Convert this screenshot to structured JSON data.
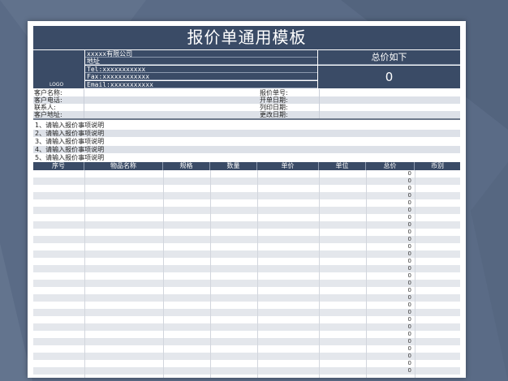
{
  "title": "报价单通用模板",
  "logo_text": "LOGO",
  "company": {
    "lines": [
      "xxxxx有限公司",
      "地址",
      "Tel:xxxxxxxxxxx",
      "Fax:xxxxxxxxxxxx",
      "Email:xxxxxxxxxxx"
    ]
  },
  "total": {
    "label": "总价如下",
    "value": "0"
  },
  "info": {
    "left_labels": [
      "客户名称:",
      "客户电话:",
      "联系人:",
      "客户地址:"
    ],
    "right_labels": [
      "报价单号:",
      "开单日期:",
      "列印日期:",
      "更改日期:"
    ]
  },
  "notes": [
    "1、请输入报价事项说明",
    "2、请输入报价事项说明",
    "3、请输入报价事项说明",
    "4、请输入报价事项说明",
    "5、请输入报价事项说明"
  ],
  "table": {
    "headers": [
      "序号",
      "物品名称",
      "规格",
      "数量",
      "单价",
      "单位",
      "总价",
      "币别"
    ],
    "total_values": [
      "0",
      "0",
      "0",
      "0",
      "0",
      "0",
      "0",
      "0",
      "0",
      "0",
      "0",
      "0",
      "0",
      "0",
      "0",
      "0",
      "0",
      "0",
      "0",
      "0",
      "0",
      "0",
      "0",
      "0",
      "0",
      "0",
      "0",
      "0"
    ]
  },
  "colors": {
    "background": "#5a6b86",
    "header": "#3a4b66",
    "row_shade": "#e4e7ec"
  }
}
